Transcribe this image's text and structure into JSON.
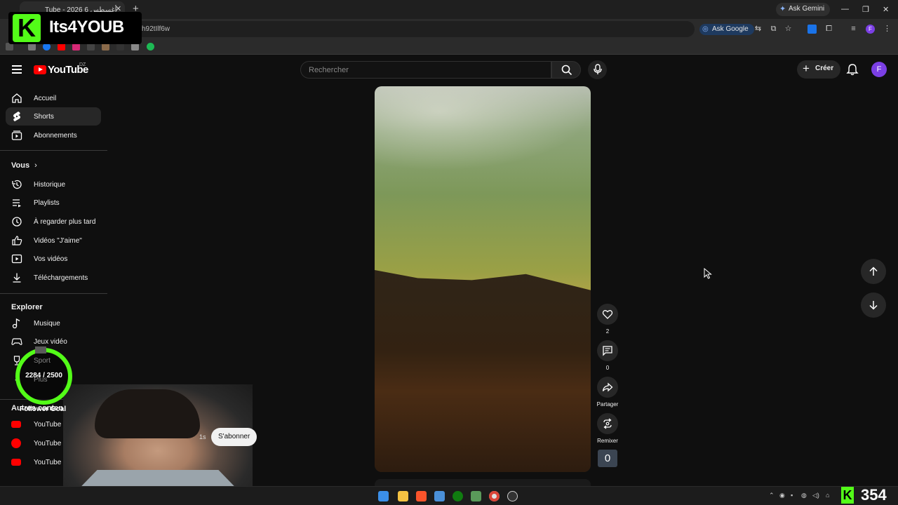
{
  "browser": {
    "tab_title": "Tube - 2026 أغسطس 6",
    "url_fragment": "h92tIlf6w",
    "ask_gemini": "Ask Gemini",
    "ask_google": "Ask Google"
  },
  "overlay": {
    "brand_name": "Its4YOUB",
    "goal_count": "2284 / 2500",
    "goal_label": "Follower Goal",
    "kick_count": "354"
  },
  "header": {
    "logo_text": "YouTube",
    "country": "DZ",
    "search_placeholder": "Rechercher",
    "create_label": "Créer",
    "avatar_initial": "F"
  },
  "sidebar": {
    "main": [
      {
        "label": "Accueil",
        "icon": "home-icon"
      },
      {
        "label": "Shorts",
        "icon": "shorts-icon"
      },
      {
        "label": "Abonnements",
        "icon": "subscriptions-icon"
      }
    ],
    "you_heading": "Vous",
    "you": [
      {
        "label": "Historique",
        "icon": "history-icon"
      },
      {
        "label": "Playlists",
        "icon": "playlists-icon"
      },
      {
        "label": "À regarder plus tard",
        "icon": "watch-later-icon"
      },
      {
        "label": "Vidéos \"J'aime\"",
        "icon": "like-icon"
      },
      {
        "label": "Vos vidéos",
        "icon": "your-videos-icon"
      },
      {
        "label": "Téléchargements",
        "icon": "download-icon"
      }
    ],
    "explore_heading": "Explorer",
    "explore": [
      {
        "label": "Musique",
        "icon": "music-icon"
      },
      {
        "label": "Jeux vidéo",
        "icon": "gaming-icon"
      },
      {
        "label": "Sport",
        "icon": "trophy-icon"
      },
      {
        "label": "Plus",
        "icon": "more-icon"
      }
    ],
    "more_heading": "Autres contenus YouTube",
    "more": [
      {
        "label": "YouTube Premium",
        "icon": "youtube-premium-icon"
      },
      {
        "label": "YouTube Music",
        "icon": "youtube-music-icon"
      },
      {
        "label": "YouTube Kids",
        "icon": "youtube-kids-icon"
      }
    ]
  },
  "short": {
    "likes": "2",
    "comments": "0",
    "share_label": "Partager",
    "remix_label": "Remixer",
    "counter": "0",
    "subscribe_label": "S'abonner",
    "time_fragment": "1s"
  },
  "colors": {
    "background": "#0f0f0f",
    "accent_red": "#ff0000",
    "kick_green": "#53fc18",
    "avatar": "#7b3fe4"
  }
}
